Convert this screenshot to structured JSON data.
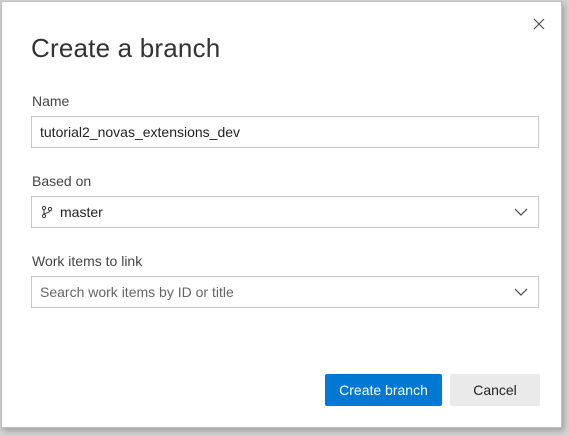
{
  "dialog": {
    "title": "Create a branch",
    "close_icon": "close-icon"
  },
  "name_field": {
    "label": "Name",
    "value": "tutorial2_novas_extensions_dev"
  },
  "based_on_field": {
    "label": "Based on",
    "value": "master",
    "icon": "branch-icon"
  },
  "work_items_field": {
    "label": "Work items to link",
    "placeholder": "Search work items by ID or title"
  },
  "actions": {
    "create_label": "Create branch",
    "cancel_label": "Cancel"
  },
  "colors": {
    "primary": "#0078d4",
    "secondary_bg": "#eaeaea"
  }
}
